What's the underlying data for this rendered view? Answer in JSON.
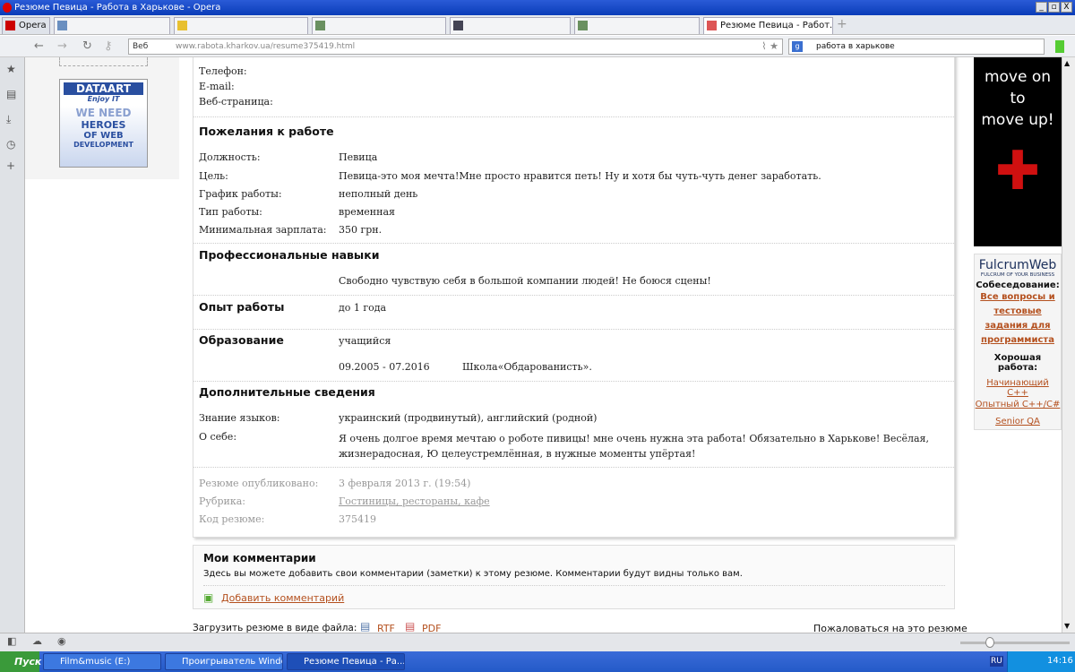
{
  "window": {
    "title": "Резюме Певица - Работа в Харькове - Opera",
    "buttons": [
      "_",
      "▫",
      "X"
    ]
  },
  "tabs": {
    "menu": "Opera",
    "items": [
      {
        "label": ""
      },
      {
        "label": ""
      },
      {
        "label": ""
      },
      {
        "label": ""
      },
      {
        "label": ""
      },
      {
        "label": "Резюме Певица - Работ..."
      }
    ],
    "close": "x",
    "new": "+"
  },
  "addressbar": {
    "veb": "Веб",
    "url": "www.rabota.kharkov.ua/resume375419.html",
    "search": "работа в харькове"
  },
  "ads": {
    "dataart_logo": "DATAART",
    "dataart_tagline": "Enjoy IT",
    "dataart_text": [
      "WE NEED",
      "HEROES",
      "OF WEB",
      "DEVELOPMENT"
    ],
    "black_text": [
      "move on",
      "to",
      "move up!"
    ],
    "fulcrum": {
      "logo": "FulcrumWeb",
      "tagline": "FULCRUM OF YOUR BUSINESS",
      "interview": "Собеседование:",
      "interview_link": "Все вопросы и тестовые задания для программиста",
      "good_job": "Хорошая работа:",
      "links": [
        "Начинающий С++",
        "Опытный С++/С#",
        "Senior QA"
      ]
    }
  },
  "contact": {
    "phone": "Телефон:",
    "email": "E-mail:",
    "web": "Веб-страница:"
  },
  "wishes": {
    "title": "Пожелания к работе",
    "rows": [
      {
        "label": "Должность:",
        "value": "Певица"
      },
      {
        "label": "Цель:",
        "value": "Певица-это моя мечта!Мне просто нравится петь! Ну и хотя бы чуть-чуть денег заработать."
      },
      {
        "label": "График работы:",
        "value": "неполный день"
      },
      {
        "label": "Тип работы:",
        "value": "временная"
      },
      {
        "label": "Минимальная зарплата:",
        "value": "350 грн."
      }
    ]
  },
  "skills": {
    "title": "Профессиональные навыки",
    "value": "Свободно чувствую себя в большой компании людей! Не боюся сцены!"
  },
  "experience": {
    "title": "Опыт работы",
    "value": "до 1 года"
  },
  "education": {
    "title": "Образование",
    "value": "учащийся",
    "period": "09.2005 - 07.2016",
    "school": "Школа«Обдарованисть»."
  },
  "extra": {
    "title": "Дополнительные сведения",
    "languages_label": "Знание языков:",
    "languages": "украинский (продвинутый), английский (родной)",
    "about_label": "О себе:",
    "about": "Я очень долгое время мечтаю о роботе пивицы! мне очень нужна эта работа! Обязательно в Харькове! Весёлая, жизнерадосная, Ю целеустремлённая, в нужные моменты упёртая!"
  },
  "meta": {
    "published_label": "Резюме опубликовано:",
    "published": "3 февраля 2013 г. (19:54)",
    "rubric_label": "Рубрика:",
    "rubric": "Гостиницы, рестораны, кафе",
    "code_label": "Код резюме:",
    "code": "375419"
  },
  "comments": {
    "title": "Мои комментарии",
    "desc": "Здесь вы можете добавить свои комментарии (заметки) к этому резюме. Комментарии будут видны только вам.",
    "add": "Добавить комментарий"
  },
  "footer": {
    "download": "Загрузить резюме в виде файла:",
    "rtf": "RTF",
    "pdf": "PDF",
    "report": "Пожаловаться на это резюме"
  },
  "taskbar": {
    "start": "Пуск",
    "items": [
      "Film&music (E:)",
      "Проигрыватель Windo...",
      "Резюме Певица - Ра..."
    ],
    "lang": "RU",
    "clock": "14:16"
  }
}
